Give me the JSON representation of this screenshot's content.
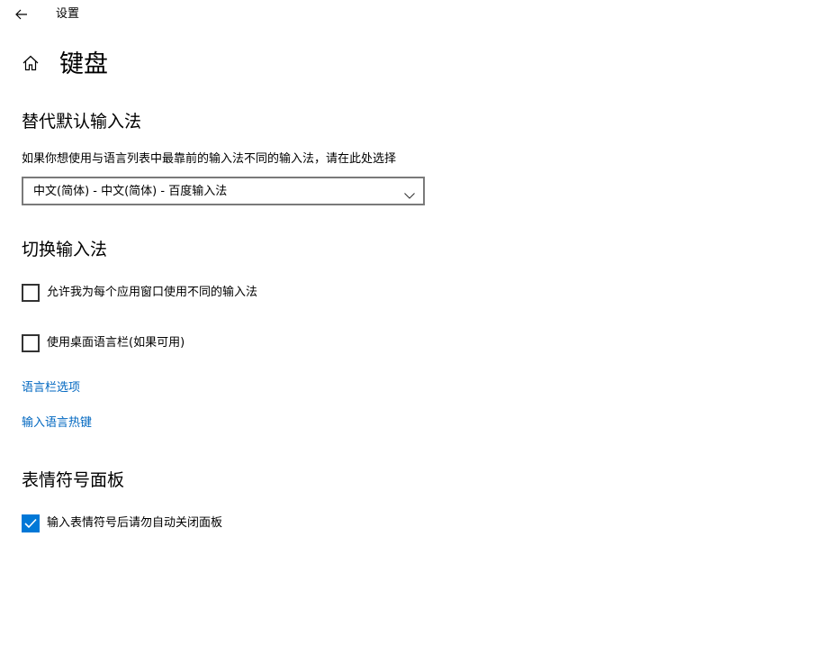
{
  "window": {
    "title": "设置"
  },
  "header": {
    "title": "键盘"
  },
  "sections": {
    "default_ime": {
      "title": "替代默认输入法",
      "description": "如果你想使用与语言列表中最靠前的输入法不同的输入法，请在此处选择",
      "dropdown_value": "中文(简体) - 中文(简体) - 百度输入法"
    },
    "switch_ime": {
      "title": "切换输入法",
      "checkbox_per_app": {
        "label": "允许我为每个应用窗口使用不同的输入法",
        "checked": false
      },
      "checkbox_langbar": {
        "label": "使用桌面语言栏(如果可用)",
        "checked": false
      },
      "link_langbar_options": "语言栏选项",
      "link_hotkeys": "输入语言热键"
    },
    "emoji_panel": {
      "title": "表情符号面板",
      "checkbox_keep_open": {
        "label": "输入表情符号后请勿自动关闭面板",
        "checked": true
      }
    }
  },
  "colors": {
    "accent": "#0078d7",
    "link": "#0067c0",
    "text": "#000000",
    "background": "#ffffff"
  },
  "icons": {
    "back": "back-arrow-icon",
    "home": "home-icon",
    "dropdown": "chevron-down-icon",
    "check": "checkmark-icon"
  }
}
